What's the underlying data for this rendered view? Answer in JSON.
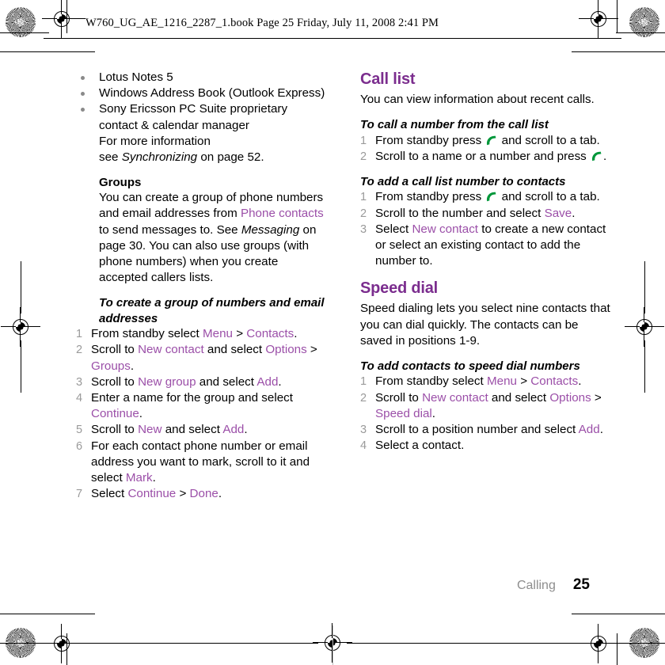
{
  "header": {
    "text": "W760_UG_AE_1216_2287_1.book  Page 25  Friday, July 11, 2008  2:41 PM"
  },
  "colors": {
    "heading_purple": "#7B2D8E",
    "inline_purple": "#9B4FA8",
    "step_number_gray": "#9a9a9a",
    "footer_gray": "#8d8d8d",
    "call_key_green": "#00973A"
  },
  "left_column": {
    "bullets": [
      "Lotus Notes 5",
      "Windows Address Book (Outlook Express)"
    ],
    "bullet3": {
      "line1": "Sony Ericsson PC Suite proprietary",
      "line2": "contact & calendar manager",
      "line3": "For more information",
      "line4_pre": "see ",
      "line4_italic": "Synchronizing",
      "line4_post": " on page 52."
    },
    "groups": {
      "heading": "Groups",
      "p1_a": "You can create a group of phone numbers and email addresses from ",
      "p1_ui": "Phone contacts",
      "p1_b": " to send messages to. See ",
      "p1_italic": "Messaging",
      "p1_c": " on page 30. You can also use groups (with phone numbers) when you create accepted callers lists."
    },
    "task": {
      "heading": "To create a group of numbers and email addresses",
      "steps": [
        {
          "p1": "From standby select ",
          "ui1": "Menu",
          "sep1": " > ",
          "ui2": "Contacts",
          "p2": "."
        },
        {
          "p1": "Scroll to ",
          "ui1": "New contact",
          "p2": " and select ",
          "ui2": "Options",
          "sep1": " > ",
          "ui3": "Groups",
          "p3": "."
        },
        {
          "p1": "Scroll to ",
          "ui1": "New group",
          "p2": " and select ",
          "ui2": "Add",
          "p3": "."
        },
        {
          "p1": "Enter a name for the group and select ",
          "ui1": "Continue",
          "p2": "."
        },
        {
          "p1": "Scroll to ",
          "ui1": "New",
          "p2": " and select ",
          "ui2": "Add",
          "p3": "."
        },
        {
          "p1": "For each contact phone number or email address you want to mark, scroll to it and select ",
          "ui1": "Mark",
          "p2": "."
        },
        {
          "p1": "Select ",
          "ui1": "Continue",
          "sep1": " > ",
          "ui2": "Done",
          "p2": "."
        }
      ]
    }
  },
  "right_column": {
    "call_list": {
      "heading": "Call list",
      "intro": "You can view information about recent calls.",
      "task1": {
        "heading": "To call a number from the call list",
        "step1_a": "From standby press ",
        "step1_icon": "call-key-icon",
        "step1_b": " and scroll to a tab.",
        "step2_a": "Scroll to a name or a number and press ",
        "step2_icon": "call-key-icon",
        "step2_b": "."
      },
      "task2": {
        "heading": "To add a call list number to contacts",
        "step1_a": "From standby press ",
        "step1_icon": "call-key-icon",
        "step1_b": " and scroll to a tab.",
        "step2_a": "Scroll to the number and select ",
        "step2_ui": "Save",
        "step2_b": ".",
        "step3_a": "Select ",
        "step3_ui": "New contact",
        "step3_b": " to create a new contact or select an existing contact to add the number to."
      }
    },
    "speed_dial": {
      "heading": "Speed dial",
      "intro": "Speed dialing lets you select nine contacts that you can dial quickly. The contacts can be saved in positions 1-9.",
      "task": {
        "heading": "To add contacts to speed dial numbers",
        "steps": [
          {
            "p1": "From standby select ",
            "ui1": "Menu",
            "sep1": " > ",
            "ui2": "Contacts",
            "p2": "."
          },
          {
            "p1": "Scroll to ",
            "ui1": "New contact",
            "p2": " and select ",
            "ui2": "Options",
            "sep1": " > ",
            "ui3": "Speed dial",
            "p3": "."
          },
          {
            "p1": "Scroll to a position number and select ",
            "ui1": "Add",
            "p2": "."
          },
          {
            "p1": "Select a contact.",
            "ui1": "",
            "p2": ""
          }
        ]
      }
    }
  },
  "footer": {
    "section": "Calling",
    "page_number": "25"
  }
}
